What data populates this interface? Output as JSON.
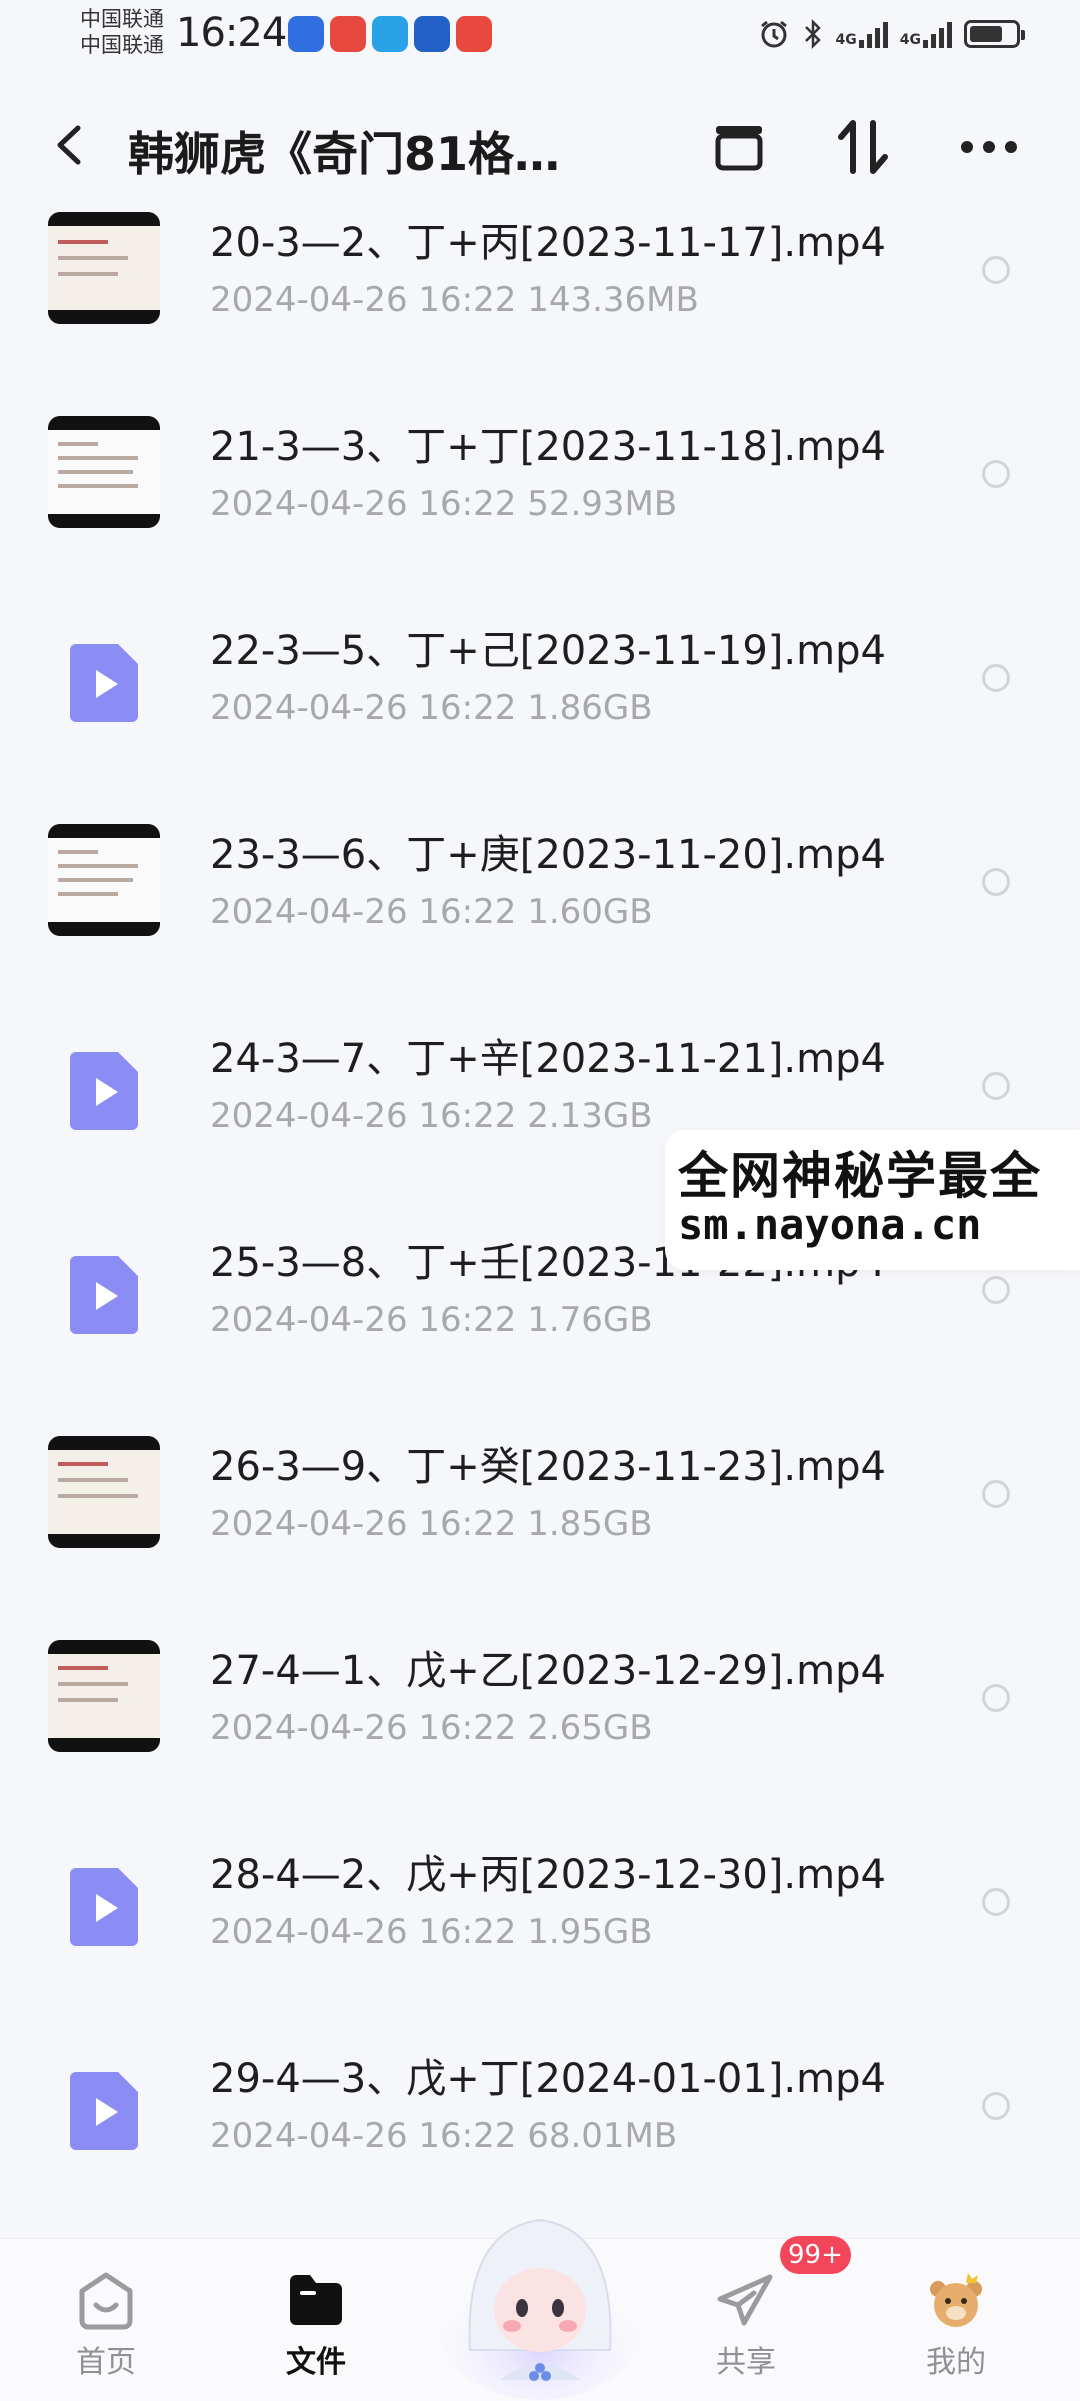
{
  "status_bar": {
    "carrier1": "中国联通",
    "carrier2": "中国联通",
    "time": "16:24",
    "network1": "4G",
    "network2": "4G"
  },
  "header": {
    "title": "韩狮虎《奇门81格…",
    "icons": [
      "back-icon",
      "archive-icon",
      "sort-icon",
      "more-icon"
    ]
  },
  "files": [
    {
      "name": "20-3—2、丁+丙[2023-11-17].mp4",
      "date": "2024-04-26",
      "time": "16:22",
      "size": "143.36MB",
      "thumb": "image"
    },
    {
      "name": "21-3—3、丁+丁[2023-11-18].mp4",
      "date": "2024-04-26",
      "time": "16:22",
      "size": "52.93MB",
      "thumb": "image"
    },
    {
      "name": "22-3—5、丁+己[2023-11-19].mp4",
      "date": "2024-04-26",
      "time": "16:22",
      "size": "1.86GB",
      "thumb": "video-icon"
    },
    {
      "name": "23-3—6、丁+庚[2023-11-20].mp4",
      "date": "2024-04-26",
      "time": "16:22",
      "size": "1.60GB",
      "thumb": "image"
    },
    {
      "name": "24-3—7、丁+辛[2023-11-21].mp4",
      "date": "2024-04-26",
      "time": "16:22",
      "size": "2.13GB",
      "thumb": "video-icon"
    },
    {
      "name": "25-3—8、丁+壬[2023-11-22].mp4",
      "date": "2024-04-26",
      "time": "16:22",
      "size": "1.76GB",
      "thumb": "video-icon"
    },
    {
      "name": "26-3—9、丁+癸[2023-11-23].mp4",
      "date": "2024-04-26",
      "time": "16:22",
      "size": "1.85GB",
      "thumb": "image"
    },
    {
      "name": "27-4—1、戊+乙[2023-12-29].mp4",
      "date": "2024-04-26",
      "time": "16:22",
      "size": "2.65GB",
      "thumb": "image"
    },
    {
      "name": "28-4—2、戊+丙[2023-12-30].mp4",
      "date": "2024-04-26",
      "time": "16:22",
      "size": "1.95GB",
      "thumb": "video-icon"
    },
    {
      "name": "29-4—3、戊+丁[2024-01-01].mp4",
      "date": "2024-04-26",
      "time": "16:22",
      "size": "68.01MB",
      "thumb": "video-icon"
    }
  ],
  "watermark": {
    "line1": "全网神秘学最全",
    "line2": "sm.nayona.cn"
  },
  "tabbar": {
    "home": "首页",
    "files": "文件",
    "share": "共享",
    "mine": "我的",
    "share_badge": "99+"
  },
  "colors": {
    "accent": "#8c8cf5",
    "badge": "#f3465a",
    "meta_text": "#a7a8ad"
  }
}
